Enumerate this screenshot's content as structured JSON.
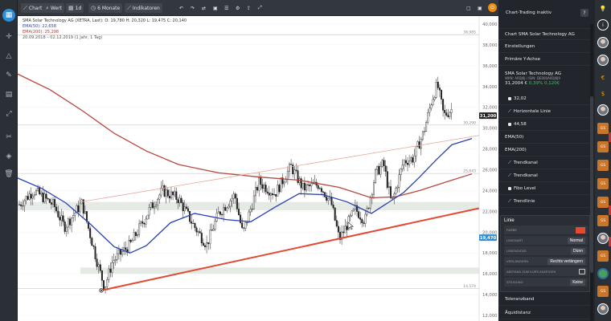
{
  "toolbar": {
    "chart": "Chart",
    "wert": "Wert",
    "interval": "1d",
    "period": "6 Monate",
    "indicators": "Indikatoren"
  },
  "legend": {
    "title": "SMA Solar Technology AG (XETRA, Last): O: 19,780  H: 20,320  L: 19,475  C: 20,140",
    "ema50": "EMA(50): 22,658",
    "ema200": "EMA(200): 25,298",
    "range": "20.09.2018 – 02.12.2019 (1 Jahr, 1 Tag)"
  },
  "axis": {
    "ticks": [
      "40,000",
      "38,000",
      "36,000",
      "34,000",
      "32,000",
      "30,000",
      "28,000",
      "26,000",
      "24,000",
      "22,000",
      "20,000",
      "18,000",
      "16,000",
      "14,000",
      "12,000"
    ],
    "price_tag": "31,200",
    "low_tag": "19,470",
    "line_labels": [
      "38,985",
      "30,290",
      "25,643",
      "14,574"
    ]
  },
  "colors": {
    "ema50": "#2a3fb5",
    "ema200": "#b8463f",
    "trend": "#e34a33",
    "price_tag": "#222222",
    "low_tag": "#2e8fd8"
  },
  "icons": {
    "left": [
      "chart-icon",
      "crosshair-icon",
      "triangle-icon",
      "brush-icon",
      "text-icon",
      "pencil-icon",
      "scissors-icon",
      "layers-icon",
      "trash-icon"
    ],
    "strip": [
      "lightbulb-icon",
      "user-icon",
      "euro-icon",
      "dollar-icon",
      "gs-logo"
    ]
  },
  "panel": {
    "header": "Chart-Trading inaktiv",
    "help": "?",
    "title": "Chart SMA Solar Technology AG",
    "settings": "Einstellungen",
    "primary_axis": "Primäre Y-Achse",
    "quote_name": "SMA Solar Technology AG",
    "quote_sub": "WKN: A0DJ6J / ISIN: DE000A0DJ6J9",
    "quote_price": "31,2004 €",
    "quote_pct": "0,39%",
    "quote_abs": "0,120€",
    "items": [
      {
        "label": "32,02",
        "type": "value"
      },
      {
        "label": "Horizontale Linie",
        "type": "line"
      },
      {
        "label": "44,58",
        "type": "value"
      },
      {
        "label": "EMA(50)",
        "type": "plain"
      },
      {
        "label": "EMA(200)",
        "type": "plain"
      },
      {
        "label": "Trendkanal",
        "type": "line"
      },
      {
        "label": "Trendkanal",
        "type": "line"
      },
      {
        "label": "Fibo Level",
        "type": "value"
      },
      {
        "label": "Trendlinie",
        "type": "line"
      }
    ]
  },
  "editor": {
    "title": "Linie",
    "farbe": "Farbe",
    "linienart": "Linienart",
    "linienart_val": "Normal",
    "liniendicke": "Liniendicke",
    "liniendicke_val": "Dünn",
    "verlaengern": "Verlängern",
    "verlaengern_val": "Rechts verlängern",
    "abstand": "Abstand zum Kurs anzeigen",
    "steigung": "Steigung",
    "steigung_val": "Keine"
  },
  "bottom": {
    "toleranzband": "Toleranzband",
    "aequidistanz": "Äquidistanz"
  }
}
